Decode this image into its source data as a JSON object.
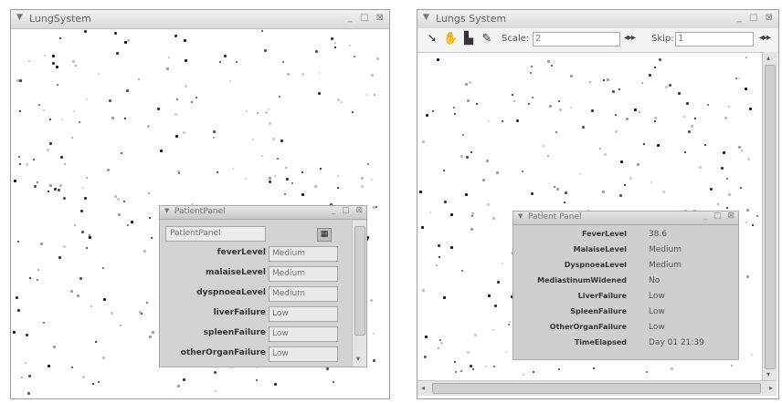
{
  "left_window": {
    "title": "LungSystem",
    "controls": [
      "_",
      "□",
      "⊠"
    ],
    "panel": {
      "title": "PatientPanel",
      "controls": [
        "_",
        "□",
        "⊠"
      ],
      "dropdown": "PatientPanel",
      "fields": [
        {
          "label": "feverLevel",
          "value": "Medium"
        },
        {
          "label": "malaiseLevel",
          "value": "Medium"
        },
        {
          "label": "dyspnoeaLevel",
          "value": "Medium"
        },
        {
          "label": "liverFailure",
          "value": "Low"
        },
        {
          "label": "spleenFailure",
          "value": "Low"
        },
        {
          "label": "otherOrganFailure",
          "value": "Low"
        }
      ]
    }
  },
  "right_window": {
    "title": "Lungs System",
    "controls": [
      "_",
      "□",
      "⊠"
    ],
    "toolbar": {
      "scale_label": "Scale:",
      "scale_value": "2",
      "skip_label": "Skip:",
      "skip_value": "1",
      "nav_arrows": "◂▸▸"
    },
    "panel": {
      "title": "Patient Panel",
      "controls": [
        "_",
        "□",
        "⊠"
      ],
      "fields": [
        {
          "label": "FeverLevel",
          "value": "38.6"
        },
        {
          "label": "MalaiseLevel",
          "value": "Medium"
        },
        {
          "label": "DyspnoeaLevel",
          "value": "Medium"
        },
        {
          "label": "MediastinumWidened",
          "value": "No"
        },
        {
          "label": "LiverFailure",
          "value": "Low"
        },
        {
          "label": "SpleenFailure",
          "value": "Low"
        },
        {
          "label": "OtherOrganFailure",
          "value": "Low"
        },
        {
          "label": "TimeElapsed",
          "value": "Day 01  21:39"
        }
      ]
    }
  },
  "icons": {
    "tool1": "select-arrow-icon",
    "tool2": "hand-pan-icon",
    "tool3": "zoom-box-icon",
    "tool4": "probe-wand-icon"
  }
}
